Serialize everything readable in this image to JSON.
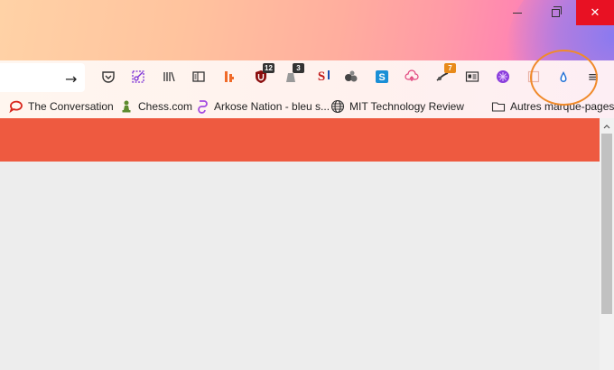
{
  "window": {
    "minimize_icon": "minimize-icon",
    "restore_icon": "restore-icon",
    "close_icon": "close-icon",
    "close_symbol": "✕"
  },
  "toolbar": {
    "go_symbol": "→",
    "extensions": [
      {
        "name": "pocket-icon",
        "badge": ""
      },
      {
        "name": "screenshot-icon",
        "badge": ""
      },
      {
        "name": "library-icon",
        "badge": ""
      },
      {
        "name": "sidebar-icon",
        "badge": ""
      },
      {
        "name": "extension-b-icon",
        "badge": ""
      },
      {
        "name": "ublock-icon",
        "badge": "12"
      },
      {
        "name": "extension-3-icon",
        "badge": "3"
      },
      {
        "name": "extension-s-icon",
        "badge": ""
      },
      {
        "name": "extension-balls-icon",
        "badge": ""
      },
      {
        "name": "skype-icon",
        "badge": ""
      },
      {
        "name": "cloud-upload-icon",
        "badge": ""
      },
      {
        "name": "extension-7-icon",
        "badge": "7"
      },
      {
        "name": "reader-icon",
        "badge": ""
      },
      {
        "name": "purple-extension-icon",
        "badge": ""
      },
      {
        "name": "panel-icon",
        "badge": ""
      },
      {
        "name": "raindrop-icon",
        "badge": ""
      },
      {
        "name": "menu-icon",
        "badge": ""
      }
    ],
    "menu_symbol": "≡"
  },
  "bookmarks": {
    "items": [
      {
        "label": "The Conversation",
        "icon": "speech-bubble-icon"
      },
      {
        "label": "Chess.com",
        "icon": "pawn-icon"
      },
      {
        "label": "Arkose Nation - bleu s...",
        "icon": "arkose-icon"
      },
      {
        "label": "MIT Technology Review",
        "icon": "globe-icon"
      }
    ],
    "other": {
      "label": "Autres marque-pages",
      "icon": "folder-icon"
    }
  },
  "colors": {
    "banner": "#ee5a40",
    "annotation": "#f08a2a",
    "close": "#e81123"
  }
}
